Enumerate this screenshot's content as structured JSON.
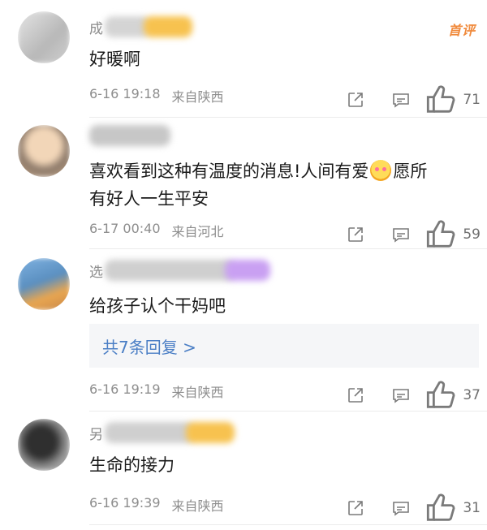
{
  "badge": "首评",
  "comments": [
    {
      "name_prefix": "成",
      "text": "好暖啊",
      "date": "6-16 19:18",
      "location": "来自陕西",
      "likes": "71",
      "avatar_colors": [
        "#d9d9d9",
        "#bdbdbd"
      ],
      "name_smear_color": "#f6c04a"
    },
    {
      "name_prefix": "",
      "text_part1": "喜欢看到这种有温度的消息!人间有爱",
      "text_part2": "愿所",
      "text_line2": "有好人一生平安",
      "date": "6-17 00:40",
      "location": "来自河北",
      "likes": "59",
      "avatar_colors": [
        "#e8c9a8",
        "#9e8a78"
      ]
    },
    {
      "name_prefix": "选",
      "text": "给孩子认个干妈吧",
      "replies": "共7条回复 >",
      "date": "6-16 19:19",
      "location": "来自陕西",
      "likes": "37",
      "avatar_colors": [
        "#6ea3d8",
        "#e6a04e"
      ],
      "name_smear_color": "#c69cf0"
    },
    {
      "name_prefix": "另",
      "text": "生命的接力",
      "date": "6-16 19:39",
      "location": "来自陕西",
      "likes": "31",
      "avatar_colors": [
        "#3a3a3a",
        "#9a9a9a"
      ],
      "name_smear_color": "#f6c04a"
    }
  ]
}
